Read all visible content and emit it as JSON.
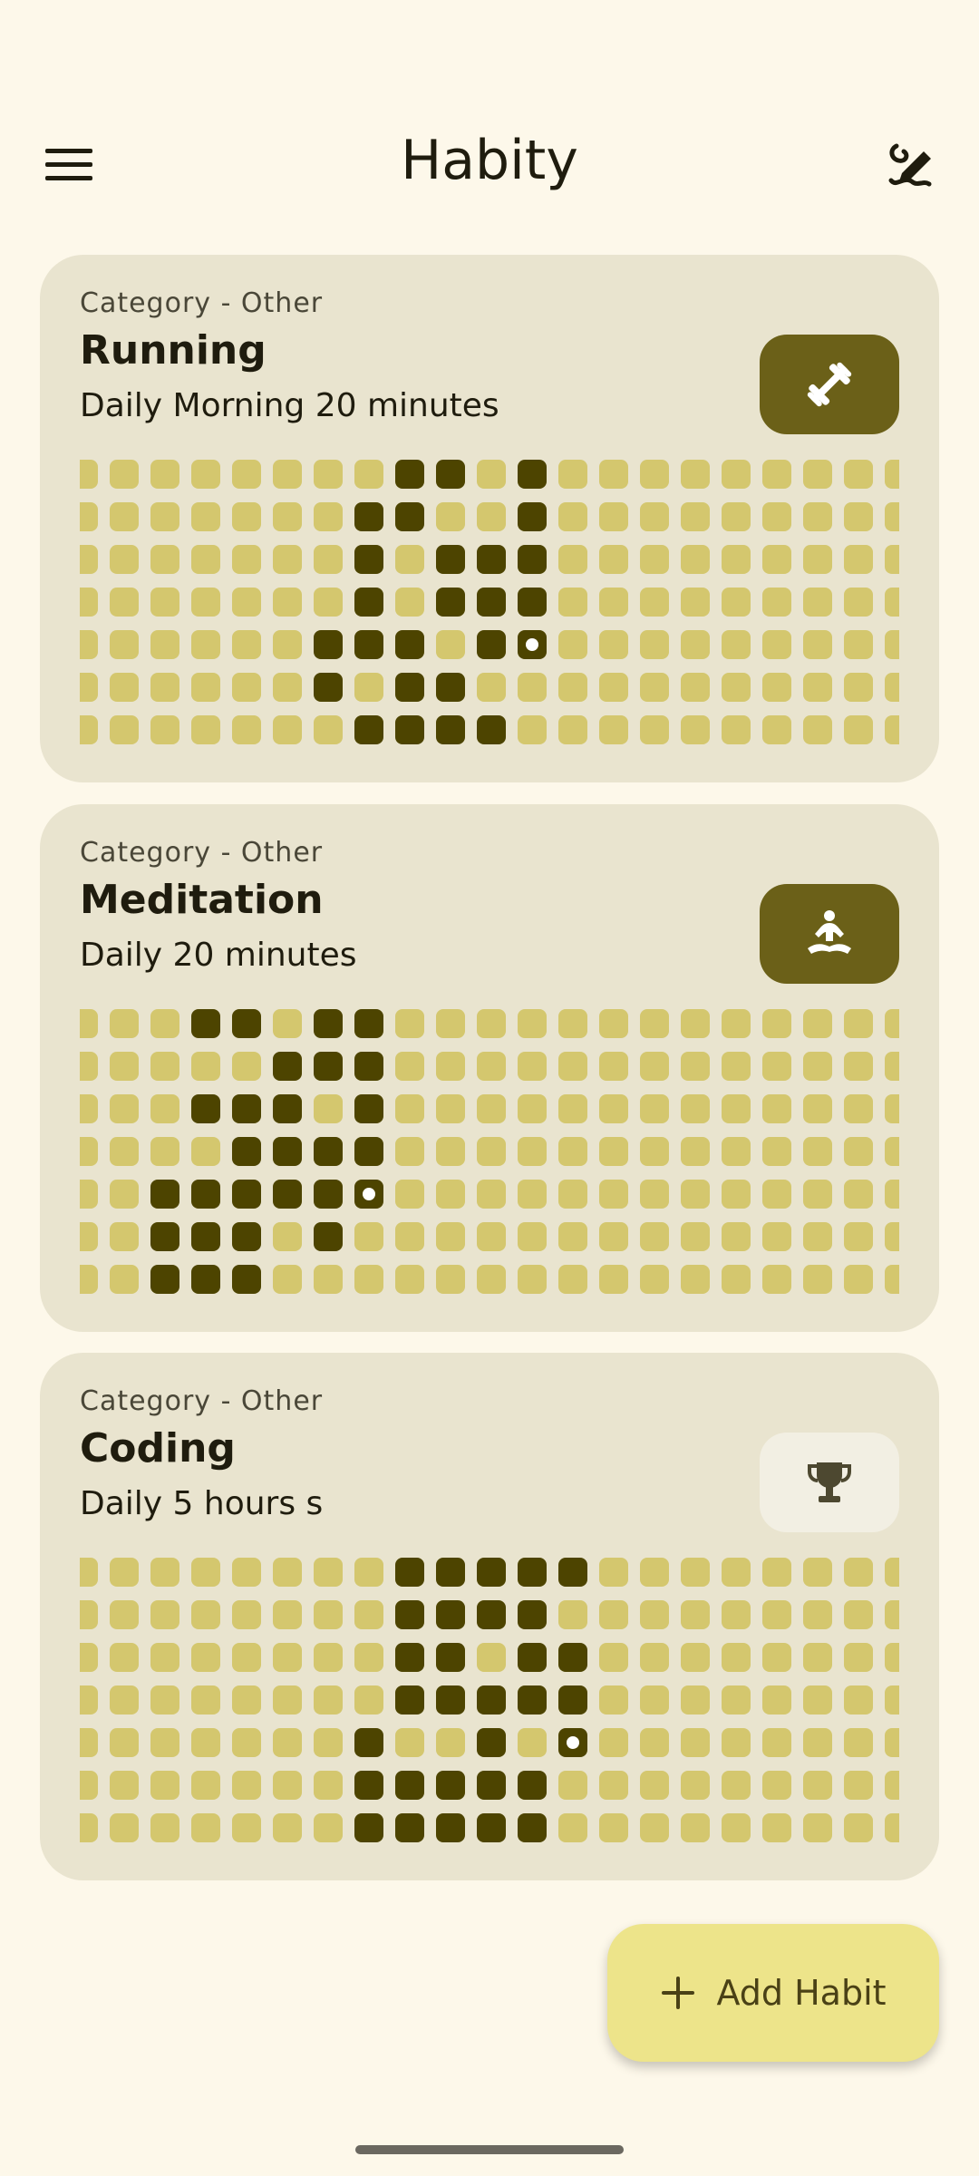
{
  "header": {
    "title": "Habity",
    "menu_icon": "menu-icon",
    "edit_icon": "edit-draw-icon"
  },
  "colors": {
    "background": "#fdf8ea",
    "card": "#e9e4cf",
    "cell_empty": "#d4c76e",
    "cell_done": "#4d4400",
    "icon_button": "#6b6018",
    "fab": "#ede48a"
  },
  "habits": [
    {
      "category": "Category - Other",
      "name": "Running",
      "description": "Daily Morning 20 minutes",
      "icon": "dumbbell-icon",
      "icon_style": "filled",
      "grid": {
        "rows": 7,
        "cols": 21,
        "done": [
          [
            0,
            8
          ],
          [
            0,
            9
          ],
          [
            0,
            11
          ],
          [
            1,
            7
          ],
          [
            1,
            8
          ],
          [
            1,
            11
          ],
          [
            2,
            7
          ],
          [
            2,
            9
          ],
          [
            2,
            10
          ],
          [
            2,
            11
          ],
          [
            3,
            7
          ],
          [
            3,
            9
          ],
          [
            3,
            10
          ],
          [
            3,
            11
          ],
          [
            4,
            6
          ],
          [
            4,
            7
          ],
          [
            4,
            8
          ],
          [
            4,
            10
          ],
          [
            5,
            6
          ],
          [
            5,
            8
          ],
          [
            5,
            9
          ],
          [
            6,
            7
          ],
          [
            6,
            8
          ],
          [
            6,
            9
          ],
          [
            6,
            10
          ]
        ],
        "today": [
          4,
          11
        ]
      }
    },
    {
      "category": "Category - Other",
      "name": "Meditation",
      "description": "Daily 20 minutes",
      "icon": "meditation-icon",
      "icon_style": "filled",
      "grid": {
        "rows": 7,
        "cols": 21,
        "done": [
          [
            0,
            3
          ],
          [
            0,
            4
          ],
          [
            0,
            6
          ],
          [
            0,
            7
          ],
          [
            1,
            5
          ],
          [
            1,
            6
          ],
          [
            1,
            7
          ],
          [
            2,
            3
          ],
          [
            2,
            4
          ],
          [
            2,
            5
          ],
          [
            2,
            7
          ],
          [
            3,
            4
          ],
          [
            3,
            5
          ],
          [
            3,
            6
          ],
          [
            3,
            7
          ],
          [
            4,
            2
          ],
          [
            4,
            3
          ],
          [
            4,
            4
          ],
          [
            4,
            5
          ],
          [
            4,
            6
          ],
          [
            5,
            2
          ],
          [
            5,
            3
          ],
          [
            5,
            4
          ],
          [
            5,
            6
          ],
          [
            6,
            2
          ],
          [
            6,
            3
          ],
          [
            6,
            4
          ]
        ],
        "today": [
          4,
          7
        ]
      }
    },
    {
      "category": "Category - Other",
      "name": "Coding",
      "description": "Daily 5 hours s",
      "icon": "trophy-icon",
      "icon_style": "tonal",
      "grid": {
        "rows": 7,
        "cols": 21,
        "done": [
          [
            0,
            8
          ],
          [
            0,
            9
          ],
          [
            0,
            10
          ],
          [
            0,
            11
          ],
          [
            0,
            12
          ],
          [
            1,
            8
          ],
          [
            1,
            9
          ],
          [
            1,
            10
          ],
          [
            1,
            11
          ],
          [
            2,
            8
          ],
          [
            2,
            9
          ],
          [
            2,
            11
          ],
          [
            2,
            12
          ],
          [
            3,
            8
          ],
          [
            3,
            9
          ],
          [
            3,
            10
          ],
          [
            3,
            11
          ],
          [
            3,
            12
          ],
          [
            4,
            7
          ],
          [
            4,
            10
          ],
          [
            5,
            7
          ],
          [
            5,
            8
          ],
          [
            5,
            9
          ],
          [
            5,
            10
          ],
          [
            5,
            11
          ],
          [
            6,
            7
          ],
          [
            6,
            8
          ],
          [
            6,
            9
          ],
          [
            6,
            10
          ],
          [
            6,
            11
          ]
        ],
        "today": [
          4,
          12
        ]
      }
    }
  ],
  "fab": {
    "label": "Add Habit",
    "icon": "plus-icon"
  }
}
